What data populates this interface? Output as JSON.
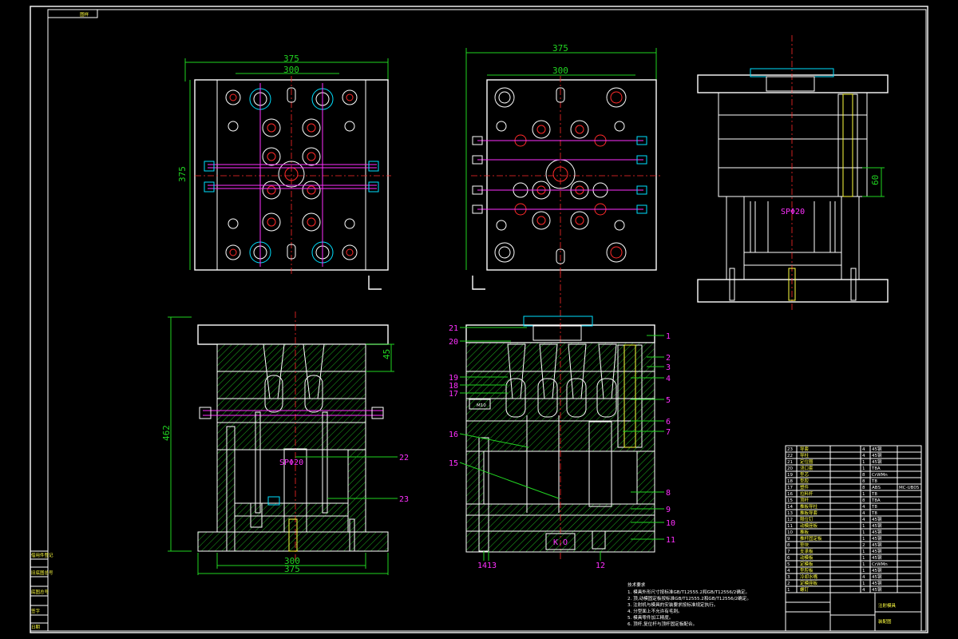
{
  "border_label": "图样",
  "top_left_view": {
    "dims": {
      "width_outer": "375",
      "width_inner": "300",
      "height": "375"
    }
  },
  "top_right_view": {
    "dims": {
      "width_outer": "375",
      "width_inner": "300"
    }
  },
  "side_view": {
    "dims": {
      "vertical": "60"
    },
    "label": "SPΦ20"
  },
  "front_section": {
    "dims": {
      "height": "462",
      "small": "45",
      "width_inner": "300",
      "width_outer": "375"
    },
    "label": "SPΦ20",
    "callouts": [
      "22",
      "23"
    ]
  },
  "right_section": {
    "callouts_right": [
      "1",
      "2",
      "3",
      "4",
      "5",
      "6",
      "7",
      "8",
      "9",
      "10",
      "11"
    ],
    "callouts_left": [
      "21",
      "20",
      "19",
      "18",
      "17",
      "16",
      "15"
    ],
    "callouts_bottom": [
      "1413",
      "12"
    ],
    "ko_label": "K.O",
    "m_label": "M10"
  },
  "tech_notes": {
    "title": "技术要求",
    "lines": [
      "1. 模具外形尺寸按标准GB/T12555.2和GB/T12556/2确定。",
      "2. 顶,动模固定板按标准GB/T12555.2和GB/T12556/2确定。",
      "3. 注射机与模具的安装要求按标准规定执行。",
      "4. 分型面上不允许有毛刺。",
      "5. 模具零件加工精度。",
      "6. 顶杆,复位杆与顶杆固定板配合。"
    ]
  },
  "parts_list": {
    "rows": [
      [
        "23",
        "导套",
        "4",
        "45钢",
        ""
      ],
      [
        "22",
        "导柱",
        "4",
        "45钢",
        ""
      ],
      [
        "21",
        "定位圈",
        "1",
        "45钢",
        ""
      ],
      [
        "20",
        "浇口套",
        "1",
        "T8A",
        ""
      ],
      [
        "19",
        "型芯",
        "8",
        "CrWMn",
        ""
      ],
      [
        "18",
        "型腔",
        "8",
        "T8",
        ""
      ],
      [
        "17",
        "塑件",
        "8",
        "ABS",
        "MC-UB05"
      ],
      [
        "16",
        "拉料杆",
        "1",
        "T8",
        ""
      ],
      [
        "15",
        "顶杆",
        "8",
        "T8A",
        ""
      ],
      [
        "14",
        "推板导柱",
        "4",
        "T8",
        ""
      ],
      [
        "13",
        "推板导套",
        "4",
        "T8",
        ""
      ],
      [
        "12",
        "限位钉",
        "4",
        "45钢",
        ""
      ],
      [
        "11",
        "动模座板",
        "1",
        "45钢",
        ""
      ],
      [
        "10",
        "推板",
        "1",
        "45钢",
        ""
      ],
      [
        "9",
        "推杆固定板",
        "1",
        "45钢",
        ""
      ],
      [
        "8",
        "垫块",
        "2",
        "45钢",
        ""
      ],
      [
        "7",
        "支承板",
        "1",
        "45钢",
        ""
      ],
      [
        "6",
        "动模板",
        "1",
        "45钢",
        ""
      ],
      [
        "5",
        "定模板",
        "1",
        "CrWMn",
        ""
      ],
      [
        "4",
        "型腔板",
        "1",
        "45钢",
        ""
      ],
      [
        "3",
        "冷却水嘴",
        "4",
        "45钢",
        ""
      ],
      [
        "2",
        "定模座板",
        "1",
        "45钢",
        ""
      ],
      [
        "1",
        "螺钉",
        "4",
        "45钢",
        ""
      ]
    ],
    "title_block": {
      "name": "注射模具",
      "sub": "装配图"
    }
  },
  "left_strip": [
    "借用件登记",
    "旧底图总号",
    "底图总号",
    "签字",
    "日期"
  ]
}
